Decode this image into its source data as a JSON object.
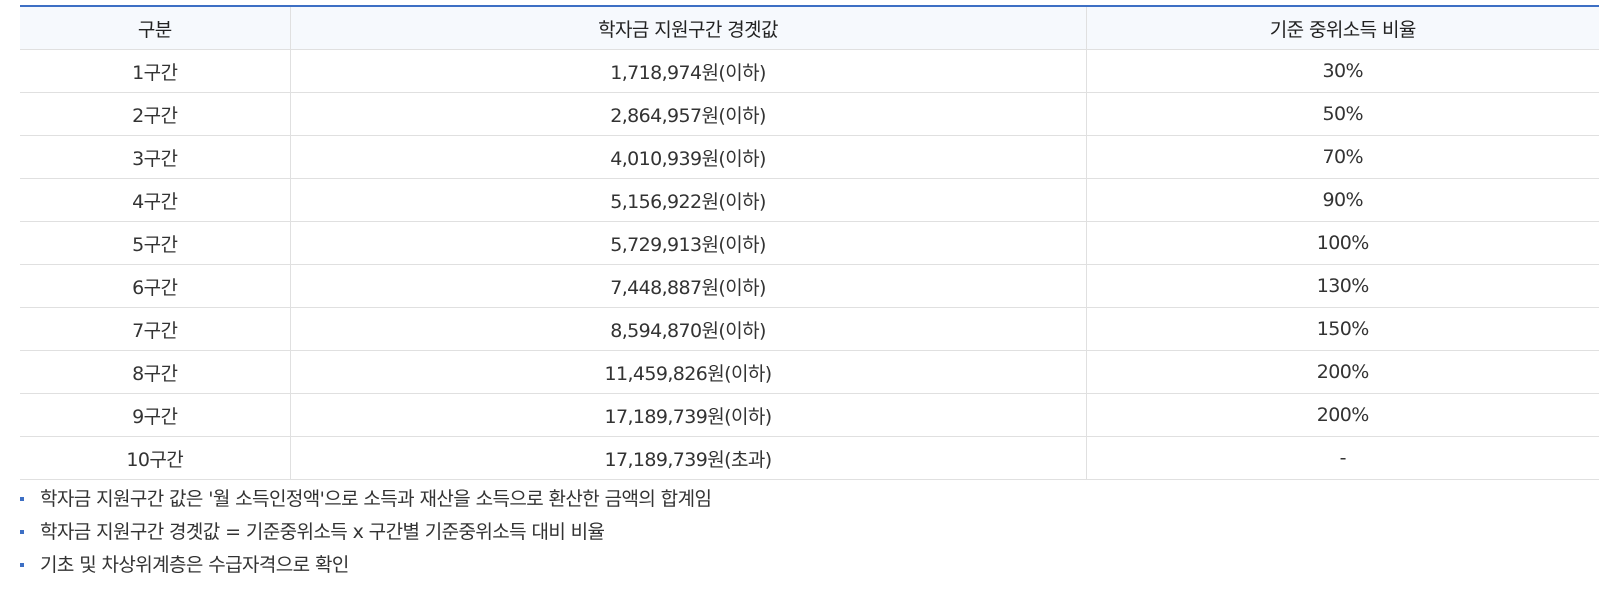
{
  "table": {
    "headers": [
      "구분",
      "학자금 지원구간 경곗값",
      "기준 중위소득 비율"
    ],
    "rows": [
      [
        "1구간",
        "1,718,974원(이하)",
        "30%"
      ],
      [
        "2구간",
        "2,864,957원(이하)",
        "50%"
      ],
      [
        "3구간",
        "4,010,939원(이하)",
        "70%"
      ],
      [
        "4구간",
        "5,156,922원(이하)",
        "90%"
      ],
      [
        "5구간",
        "5,729,913원(이하)",
        "100%"
      ],
      [
        "6구간",
        "7,448,887원(이하)",
        "130%"
      ],
      [
        "7구간",
        "8,594,870원(이하)",
        "150%"
      ],
      [
        "8구간",
        "11,459,826원(이하)",
        "200%"
      ],
      [
        "9구간",
        "17,189,739원(이하)",
        "200%"
      ],
      [
        "10구간",
        "17,189,739원(초과)",
        "-"
      ]
    ]
  },
  "notes": [
    "학자금 지원구간 값은 '월 소득인정액'으로 소득과 재산을 소득으로 환산한 금액의 합계임",
    "학자금 지원구간 경곗값 = 기준중위소득 x 구간별 기준중위소득 대비 비율",
    "기초 및 차상위계층은 수급자격으로 확인"
  ],
  "colors": {
    "accent": "#3d6fc4",
    "header_bg": "#f6f9fd",
    "border": "#e0e0e0"
  }
}
